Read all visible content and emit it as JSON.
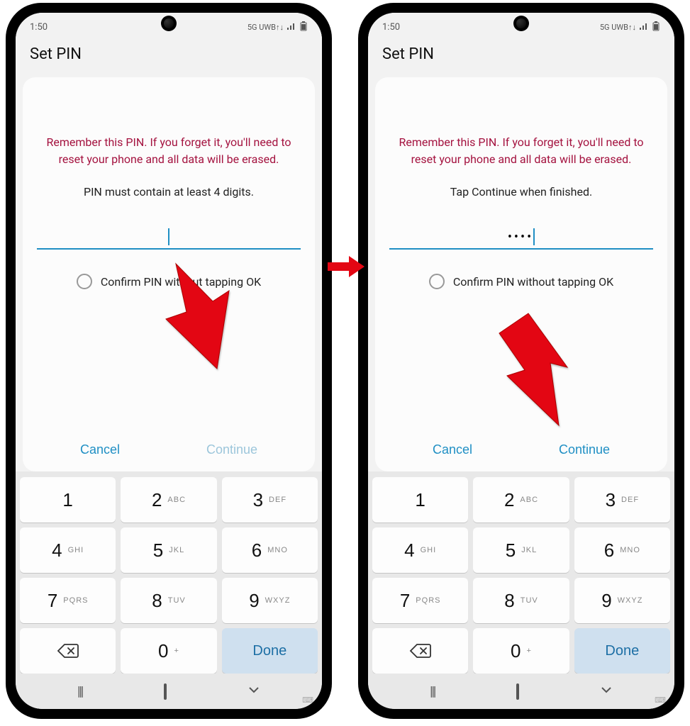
{
  "status": {
    "time": "1:50",
    "network": "5G UWB↑↓",
    "signal_icon": "signal-icon",
    "battery_icon": "battery-icon"
  },
  "screens": {
    "left": {
      "title": "Set PIN",
      "warning": "Remember this PIN. If you forget it, you'll need to reset your phone and all data will be erased.",
      "hint": "PIN must contain at least 4 digits.",
      "pin_display": "",
      "confirm_label": "Confirm PIN without tapping OK",
      "cancel": "Cancel",
      "continue": "Continue",
      "continue_enabled": false
    },
    "right": {
      "title": "Set PIN",
      "warning": "Remember this PIN. If you forget it, you'll need to reset your phone and all data will be erased.",
      "hint": "Tap Continue when finished.",
      "pin_display": "••••",
      "confirm_label": "Confirm PIN without tapping OK",
      "cancel": "Cancel",
      "continue": "Continue",
      "continue_enabled": true
    }
  },
  "keypad": {
    "keys": [
      {
        "digit": "1",
        "letters": ""
      },
      {
        "digit": "2",
        "letters": "ABC"
      },
      {
        "digit": "3",
        "letters": "DEF"
      },
      {
        "digit": "4",
        "letters": "GHI"
      },
      {
        "digit": "5",
        "letters": "JKL"
      },
      {
        "digit": "6",
        "letters": "MNO"
      },
      {
        "digit": "7",
        "letters": "PQRS"
      },
      {
        "digit": "8",
        "letters": "TUV"
      },
      {
        "digit": "9",
        "letters": "WXYZ"
      },
      {
        "digit": "backspace",
        "letters": ""
      },
      {
        "digit": "0",
        "letters": "+"
      },
      {
        "digit": "Done",
        "letters": ""
      }
    ]
  },
  "colors": {
    "accent": "#1f8fc4",
    "warning_text": "#a4123f",
    "arrow": "#e30613"
  }
}
